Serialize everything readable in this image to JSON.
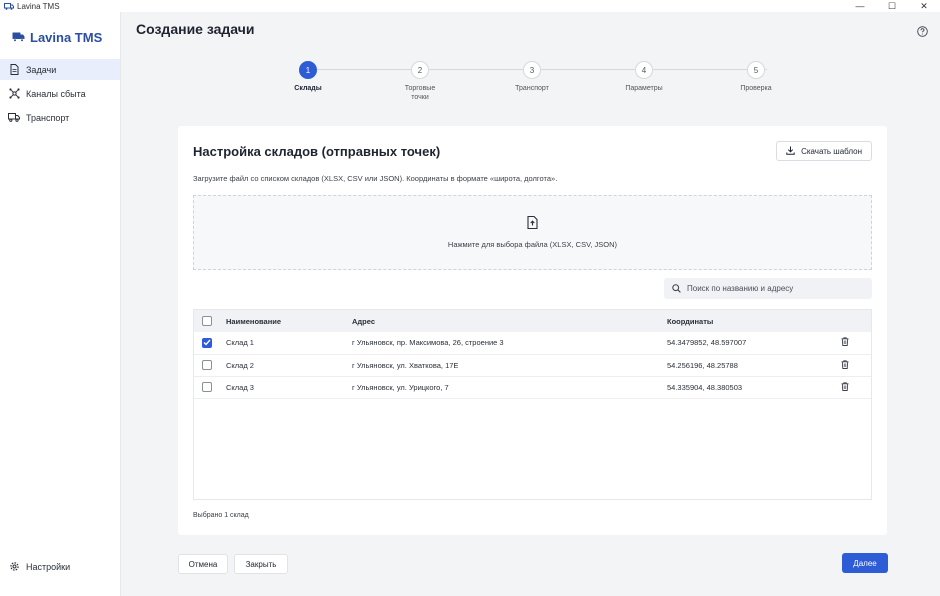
{
  "window": {
    "title": "Lavina TMS",
    "controls": [
      "—",
      "☐",
      "✕"
    ]
  },
  "sidebar": {
    "brand": "Lavina TMS",
    "items": [
      {
        "label": "Задачи",
        "icon": "document-icon",
        "active": true
      },
      {
        "label": "Каналы сбыта",
        "icon": "network-icon",
        "active": false
      },
      {
        "label": "Транспорт",
        "icon": "truck-icon",
        "active": false
      }
    ],
    "settings_label": "Настройки"
  },
  "header": {
    "title": "Создание задачи"
  },
  "stepper": {
    "current": 1,
    "steps": [
      {
        "number": "1",
        "label": "Склады"
      },
      {
        "number": "2",
        "label": "Торговые точки"
      },
      {
        "number": "3",
        "label": "Транспорт"
      },
      {
        "number": "4",
        "label": "Параметры"
      },
      {
        "number": "5",
        "label": "Проверка"
      }
    ]
  },
  "card": {
    "title": "Настройка складов (отправных точек)",
    "download_template_label": "Скачать шаблон",
    "description": "Загрузите файл со списком складов (XLSX, CSV или JSON). Координаты в формате «широта, долгота».",
    "dropzone_text": "Нажмите для выбора файла (XLSX, CSV, JSON)",
    "search_placeholder": "Поиск по названию и адресу",
    "table": {
      "columns": [
        "Наименование",
        "Адрес",
        "Координаты"
      ],
      "rows": [
        {
          "checked": true,
          "name": "Склад 1",
          "address": "г Ульяновск, пр. Максимова, 26, строение 3",
          "coords": "54.3479852, 48.597007"
        },
        {
          "checked": false,
          "name": "Склад 2",
          "address": "г Ульяновск, ул. Хваткова, 17Е",
          "coords": "54.256196, 48.25788"
        },
        {
          "checked": false,
          "name": "Склад 3",
          "address": "г Ульяновск, ул. Урицкого, 7",
          "coords": "54.335904, 48.380503"
        }
      ]
    },
    "selected_text": "Выбрано 1 склад"
  },
  "footer": {
    "cancel_label": "Отмена",
    "close_label": "Закрыть",
    "next_label": "Далее"
  },
  "colors": {
    "accent": "#2e5bd6",
    "brand": "#2b4ea2"
  }
}
